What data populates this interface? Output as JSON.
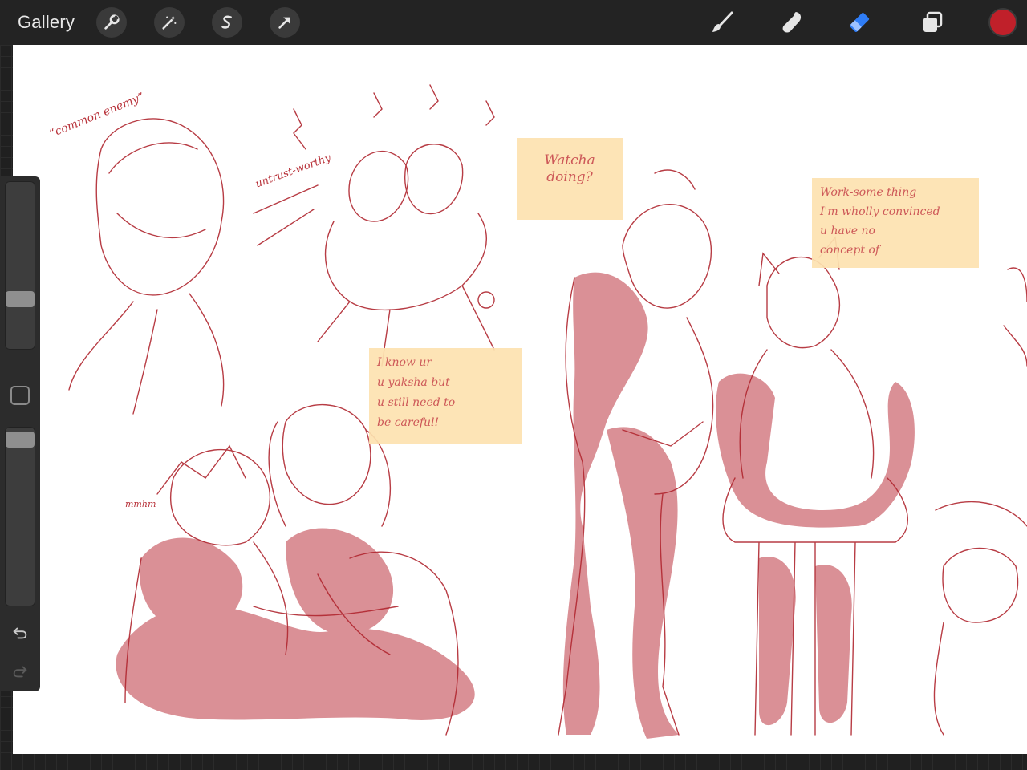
{
  "app": {
    "gallery_label": "Gallery"
  },
  "toolbar_left": [
    {
      "name": "actions-wrench-icon"
    },
    {
      "name": "adjustments-wand-icon"
    },
    {
      "name": "selection-s-icon"
    },
    {
      "name": "transform-arrow-icon"
    }
  ],
  "toolbar_right": [
    {
      "name": "brush-icon"
    },
    {
      "name": "smudge-icon"
    },
    {
      "name": "eraser-icon",
      "active": true
    },
    {
      "name": "layers-icon"
    }
  ],
  "colors": {
    "current_color": "#c0202a",
    "active_tool": "#2f7df6",
    "sketch": "#b02730",
    "fill": "#d47d84",
    "bubble": "#fde2b0"
  },
  "sidebar": {
    "brush_size_level": 0.28,
    "opacity_level": 0.09,
    "modify_icon": "square-icon",
    "undo_icon": "undo-icon",
    "redo_icon": "redo-icon"
  },
  "canvas": {
    "notes": {
      "common_enemy": "“common enemy”",
      "untrustworthy": "untrust-worthy",
      "mmhm": "mmhm"
    },
    "bubbles": {
      "watcha": "Watcha\ndoing?",
      "work": "Work-some thing\nI'm wholly convinced\nu have no\nconcept of",
      "yaksha": "I know ur\nu yaksha but\nu still need to\nbe careful!"
    }
  }
}
